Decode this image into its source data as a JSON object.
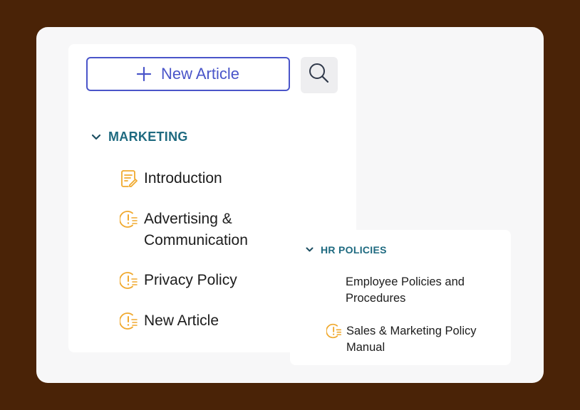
{
  "toolbar": {
    "new_article_label": "New Article",
    "icons": {
      "add": "plus-icon",
      "search": "search-icon"
    }
  },
  "sections": {
    "marketing": {
      "title": "MARKETING",
      "expanded": true,
      "items": [
        {
          "label": "Introduction",
          "icon": "article-edit-icon"
        },
        {
          "label": "Advertising & Communication",
          "icon": "alert-list-icon"
        },
        {
          "label": "Privacy Policy",
          "icon": "alert-list-icon"
        },
        {
          "label": "New Article",
          "icon": "alert-list-icon"
        }
      ]
    },
    "hr_policies": {
      "title": "HR POLICIES",
      "expanded": true,
      "items": [
        {
          "label": "Employee Policies and Procedures",
          "icon": ""
        },
        {
          "label": "Sales & Marketing Policy Manual",
          "icon": "alert-list-icon"
        }
      ]
    }
  },
  "colors": {
    "background": "#4a2307",
    "accent": "#4a55c9",
    "section_title": "#1e6a80",
    "icon_warning": "#f0a92e"
  }
}
